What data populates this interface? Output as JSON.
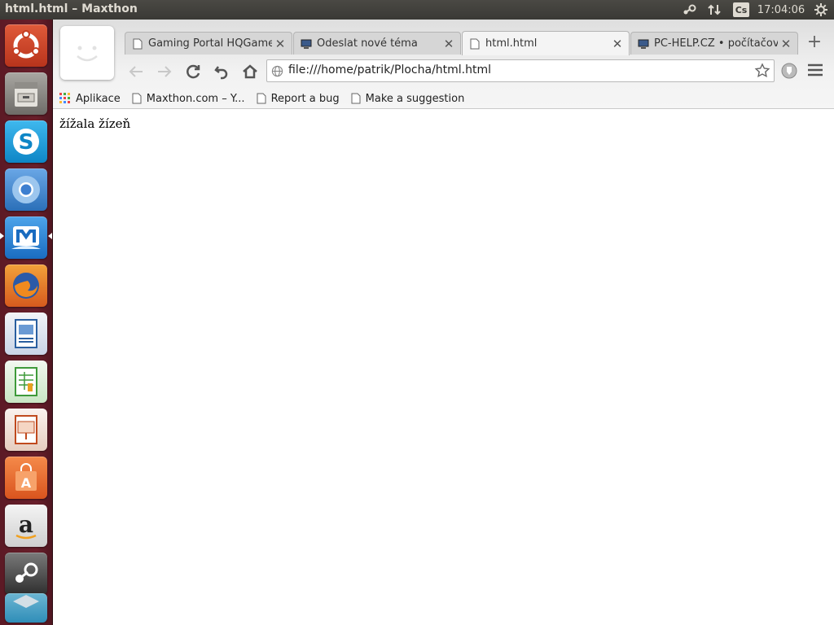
{
  "top_panel": {
    "window_title": "html.html – Maxthon",
    "lang_indicator": "Cs",
    "clock": "17:04:06"
  },
  "launcher": {
    "items": [
      {
        "name": "ubuntu-dash",
        "color": "#d94a2a"
      },
      {
        "name": "files",
        "color": "#8c8a86"
      },
      {
        "name": "skype",
        "color": "#1aa5e0"
      },
      {
        "name": "chromium",
        "color": "#4b8ed6"
      },
      {
        "name": "maxthon",
        "color": "#2a7fd0"
      },
      {
        "name": "firefox",
        "color": "#e8702a"
      },
      {
        "name": "libreoffice-writer",
        "color": "#2a5fa0"
      },
      {
        "name": "libreoffice-calc",
        "color": "#3e9a3a"
      },
      {
        "name": "libreoffice-impress",
        "color": "#c04a1e"
      },
      {
        "name": "software-center",
        "color": "#e86a2a"
      },
      {
        "name": "amazon",
        "color": "#c9c9c9"
      },
      {
        "name": "steam",
        "color": "#4a4a4a"
      }
    ]
  },
  "browser": {
    "tabs": [
      {
        "label": "Gaming Portal HQGame.e",
        "active": false
      },
      {
        "label": "Odeslat nové téma",
        "active": false
      },
      {
        "label": "html.html",
        "active": true
      },
      {
        "label": "PC-HELP.CZ • počítačové",
        "active": false
      }
    ],
    "new_tab_label": "+",
    "url": "file:///home/patrik/Plocha/html.html",
    "bookmarks": [
      {
        "label": "Aplikace",
        "icon": "apps-grid-icon"
      },
      {
        "label": "Maxthon.com – Y...",
        "icon": "page-icon"
      },
      {
        "label": "Report a bug",
        "icon": "page-icon"
      },
      {
        "label": "Make a suggestion",
        "icon": "page-icon"
      }
    ]
  },
  "page": {
    "body_text": "žížala žízeň"
  }
}
